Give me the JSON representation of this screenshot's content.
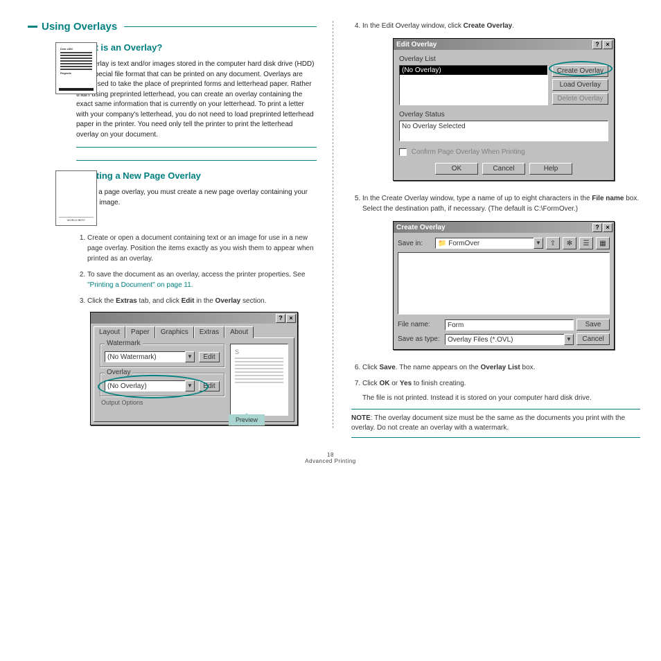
{
  "page": {
    "section_title": "Using Overlays",
    "what_heading": "What is an Overlay?",
    "what_body1": "An overlay is text and/or images stored in the computer hard disk drive (HDD) as a special file format that can be printed on any document. Overlays are often used to take the place of preprinted forms and letterhead paper. Rather than using preprinted letterhead, you can create an overlay containing the exact same information that is currently on your letterhead. To print a letter with your company's letterhead, you do not need to load preprinted letterhead paper in the printer. You need only tell the printer to print the letterhead overlay on your document.",
    "create_heading": "Creating a New Page Overlay",
    "create_body1": "To use a page overlay, you must create a new page overlay containing your logo or image.",
    "step1": "Create or open a document containing text or an image for use in a new page overlay. Position the items exactly as you wish them to appear when printed as an overlay.",
    "step2a": "To save the document as an overlay, access the printer properties. See ",
    "step2b": "\"Printing a Document\" on page 11.",
    "step3a": "Click the ",
    "step3b": "Extras",
    "step3c": " tab, and click ",
    "step3d": "Edit",
    "step3e": " in the ",
    "step3f": "Overlay",
    "step3g": " section.",
    "preview_label": "Preview",
    "thumb1_title": "Dear ABC",
    "thumb1_regards": "Regards",
    "thumb_footer": "WORLD BEST",
    "step4a": "In the Edit Overlay window, click ",
    "step4b": "Create Overlay",
    "step4c": ".",
    "step5a": "In the Create Overlay window, type a name of up to eight characters in the ",
    "step5b": "File name",
    "step5c": " box. Select the destination path, if necessary. (The default is C:\\FormOver.)",
    "step6a": "Click ",
    "step6b": "Save",
    "step6c": ". The name appears on the ",
    "step6d": "Overlay List",
    "step6e": " box.",
    "step7a": "Click ",
    "step7b": "OK",
    "step7c": " or ",
    "step7d": "Yes",
    "step7e": " to finish creating.",
    "step7_body": "The file is not printed. Instead it is stored on your computer hard disk drive.",
    "note_label": "NOTE",
    "note_body": ": The overlay document size must be the same as the documents you print with the overlay. Do not create an overlay with a watermark.",
    "footer_line1": "18",
    "footer_line2": "Advanced Printing"
  },
  "tabs_dialog": {
    "tabs": [
      "Layout",
      "Paper",
      "Graphics",
      "Extras",
      "About"
    ],
    "watermark_label": "Watermark",
    "watermark_value": "(No Watermark)",
    "edit": "Edit",
    "overlay_label": "Overlay",
    "overlay_value": "(No Overlay)",
    "output_label": "Output Options"
  },
  "edit_overlay": {
    "title": "Edit Overlay",
    "list_label": "Overlay List",
    "list_value": "(No Overlay)",
    "create": "Create Overlay",
    "load": "Load Overlay",
    "delete": "Delete Overlay",
    "status_label": "Overlay Status",
    "status_value": "No Overlay Selected",
    "confirm": "Confirm Page Overlay When Printing",
    "ok": "OK",
    "cancel": "Cancel",
    "help": "Help"
  },
  "create_overlay": {
    "title": "Create Overlay",
    "savein": "Save in:",
    "folder": "FormOver",
    "filename_label": "File name:",
    "filename_value": "Form",
    "type_label": "Save as type:",
    "type_value": "Overlay Files (*.OVL)",
    "save": "Save",
    "cancel": "Cancel"
  }
}
